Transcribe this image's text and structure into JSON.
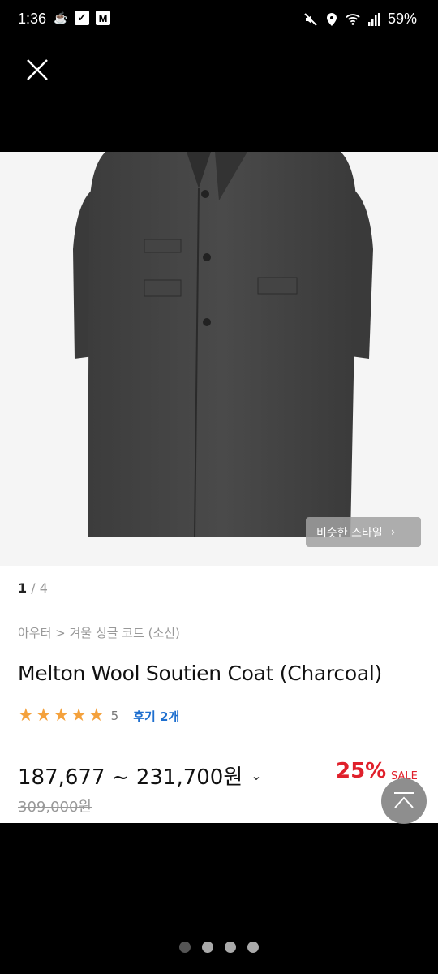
{
  "status_bar": {
    "time": "1:36",
    "battery": "59%",
    "left_icons": [
      "coffee-icon",
      "check-icon",
      "gmail-icon"
    ],
    "right_icons": [
      "mute-icon",
      "location-icon",
      "wifi-icon",
      "signal-icon"
    ]
  },
  "gallery": {
    "similar_style_label": "비슷한 스타일",
    "pager_current": "1",
    "pager_sep": " / ",
    "pager_total": "4"
  },
  "product": {
    "breadcrumb": "아우터 > 겨울 싱글 코트 (소신)",
    "title": "Melton Wool Soutien Coat (Charcoal)",
    "rating_score": "5",
    "stars": 5,
    "review_label": "후기 2개",
    "price_range": "187,677 ~ 231,700원",
    "original_price": "309,000원",
    "discount": "25%",
    "sale_label": "SALE"
  },
  "colors": {
    "star": "#f4a13c",
    "discount": "#e0202b",
    "review_link": "#1e6fcf"
  }
}
